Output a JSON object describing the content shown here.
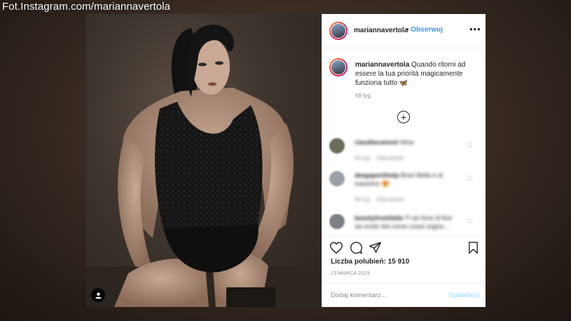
{
  "watermark": "Fot.Instagram.com/mariannavertola",
  "post": {
    "username": "mariannavertola",
    "separator": "•",
    "follow_label": "Obserwuj",
    "more_label": "•••",
    "caption": "Quando ritorni ad essere la tua priorità magicamente funziona tutto",
    "caption_emoji": "🦋",
    "age": "69 tyg.",
    "load_more_label": "+",
    "likes_label": "Liczba polubień:",
    "likes_count": "15 910",
    "date": "13 MARCA 2019",
    "add_comment_placeholder": "Dodaj komentarz...",
    "publish_label": "Opublikuj"
  },
  "comments": [
    {
      "user": "claudiacamoni",
      "text": "Wow",
      "time": "65 tyg.",
      "reply": "Odpowiedz"
    },
    {
      "user": "akagaporkhelp",
      "text": "Bravi Bella e al massimo 😍",
      "time": "68 tyg.",
      "reply": "Odpowiedz"
    },
    {
      "user": "beautyfromitalia",
      "text": "Ti sei fiore di fiori sei erotic tint come cuore sogno...",
      "time": "",
      "reply": ""
    }
  ],
  "icons": {
    "heart": "heart-icon",
    "comment": "comment-icon",
    "share": "share-icon",
    "bookmark": "bookmark-icon",
    "user": "user-tag-icon"
  },
  "colors": {
    "link_blue": "#3897f0",
    "publish_disabled": "#b2dffc",
    "muted": "#8e8e8e",
    "text": "#262626"
  }
}
